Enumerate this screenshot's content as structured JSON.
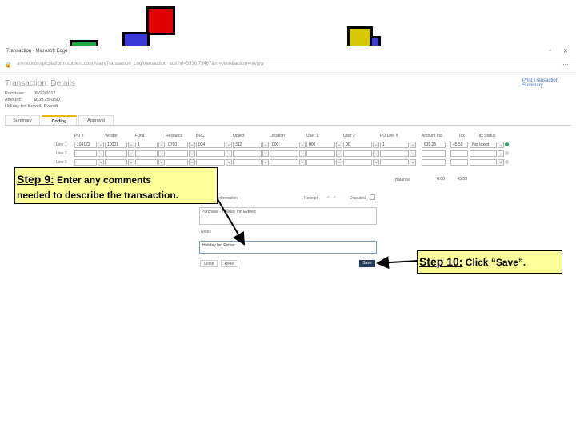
{
  "window": {
    "title": "Transaction - Microsoft Edge",
    "url": "amnviticonspicplatform.sutrient.com/Main/Transaction_Log/transaction_edit?id=5336 73467&m=view&action=review"
  },
  "page": {
    "title": "Transaction: Details",
    "print_link": "Print Transaction Summary"
  },
  "summary_info": [
    {
      "label": "Purchase:",
      "value": "08/22/2017"
    },
    {
      "label": "Amount:",
      "value": "$639.25 USD"
    },
    {
      "label": "Holiday Inn Soweit, Everett",
      "value": ""
    }
  ],
  "tabs": [
    {
      "label": "Summary",
      "active": false
    },
    {
      "label": "Coding",
      "active": true
    },
    {
      "label": "Approval",
      "active": false
    }
  ],
  "grid": {
    "headers": [
      "PO #",
      "Vendor",
      "Fund",
      "Resource",
      "BRC",
      "Object",
      "Location",
      "User 1",
      "User 2",
      "PO Line #",
      "Amount Incl.",
      "Tax",
      "Tax Status"
    ],
    "rows": [
      {
        "label": "Line 1",
        "values": [
          "104172",
          "10001",
          "1",
          "0760",
          "034",
          "312",
          "000",
          "000",
          "00",
          "1",
          "639.25",
          "45.59",
          "Not taxed"
        ]
      },
      {
        "label": "Line 2",
        "values": [
          "",
          "",
          "",
          "",
          "",
          "",
          "",
          "",
          "",
          "",
          "",
          "",
          ""
        ]
      },
      {
        "label": "Line 3",
        "values": [
          "",
          "",
          "",
          "",
          "",
          "",
          "",
          "",
          "",
          "",
          "",
          "",
          ""
        ]
      }
    ],
    "balance_label": "Balance",
    "balance_values": [
      "0.00",
      "45.59"
    ]
  },
  "details": {
    "section_label": "Information",
    "receipt_label": "Receipt",
    "disputed_label": "Disputed",
    "description_value": "Purchase - Holiday Inn Everett",
    "notes_label": "Notes",
    "notes_value": "Holiday Inn Esther",
    "buttons": {
      "close": "Close",
      "reset": "Reset",
      "save": "Save"
    }
  },
  "callouts": {
    "step9": {
      "num": "Step 9:",
      "text1": " Enter any comments",
      "text2": "needed to describe the transaction."
    },
    "step10": {
      "num": "Step 10:",
      "text": " Click “Save”."
    }
  },
  "colors": {
    "callout_bg": "#ffff99",
    "save_button": "#233a5e",
    "active_tab_accent": "#f0b400",
    "deco_red": "#e00000",
    "deco_blue": "#3a3ad6",
    "deco_yellow": "#d8c800",
    "deco_green": "#22aa44"
  }
}
